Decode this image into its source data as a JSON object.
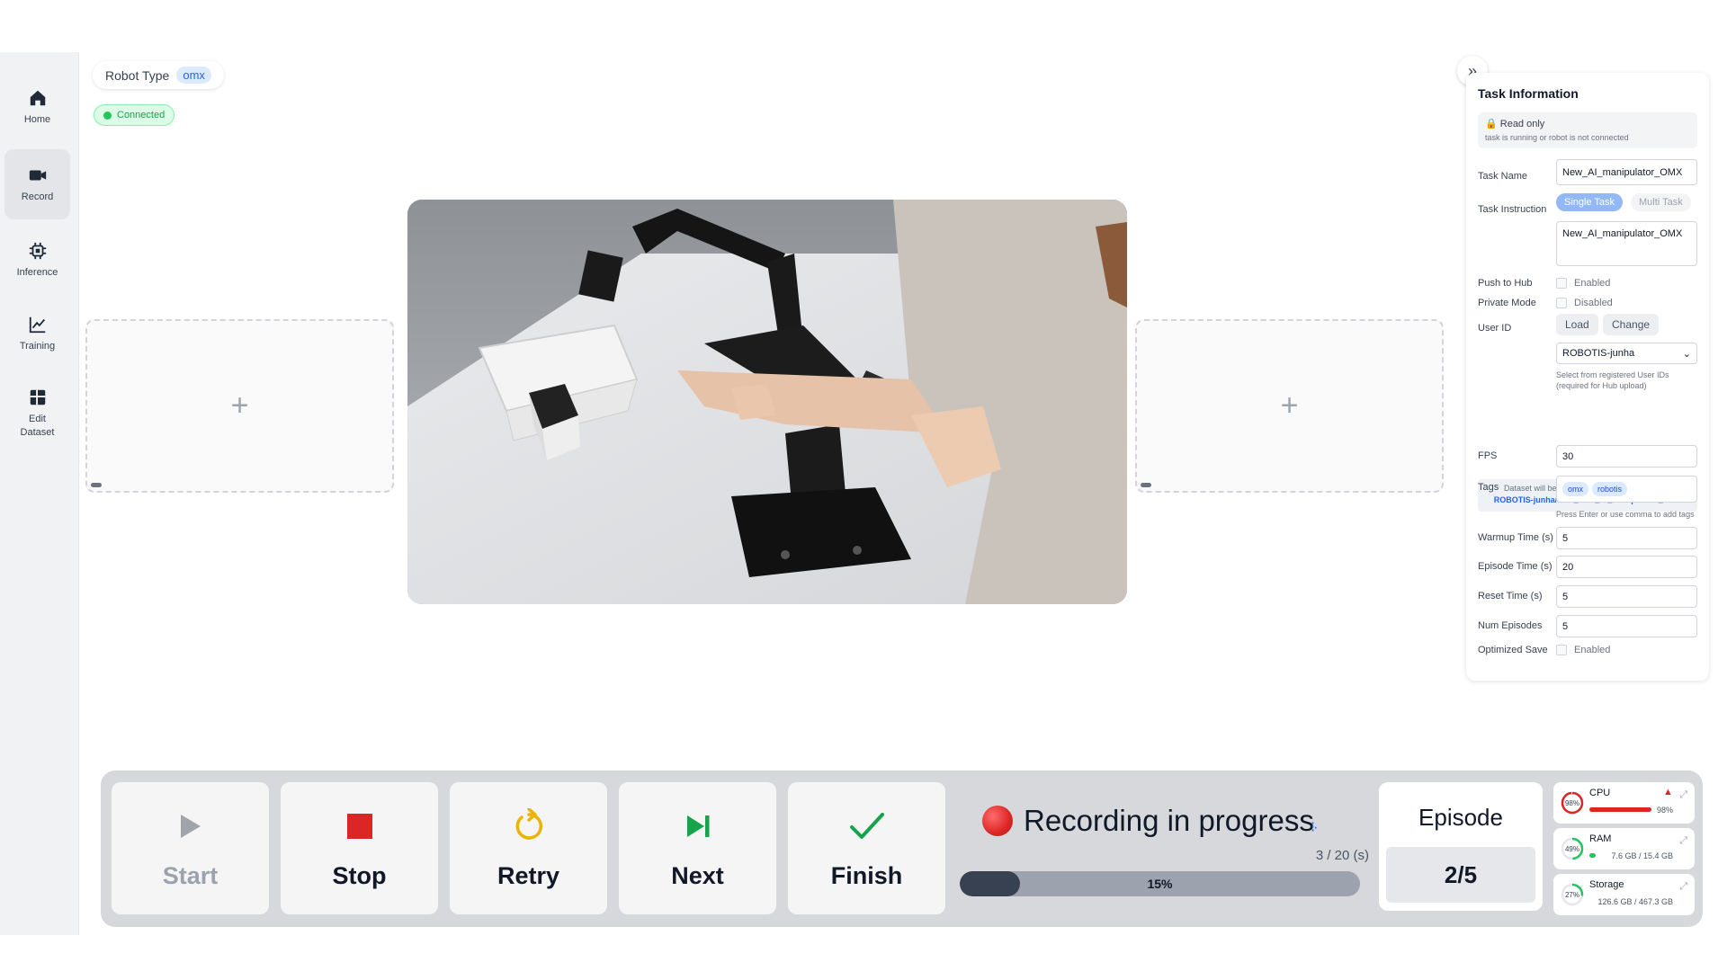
{
  "sidebar": {
    "items": [
      {
        "label": "Home",
        "icon": "home-icon"
      },
      {
        "label": "Record",
        "icon": "video-camera-icon",
        "active": true
      },
      {
        "label": "Inference",
        "icon": "chip-icon"
      },
      {
        "label": "Training",
        "icon": "chart-line-icon"
      },
      {
        "label": "Edit\nDataset",
        "icon": "grid-icon"
      }
    ]
  },
  "header": {
    "robot_type_label": "Robot Type",
    "robot_type_value": "omx",
    "status": "Connected"
  },
  "task": {
    "title": "Task Information",
    "readonly_title": "🔒 Read only",
    "readonly_desc": "task is running or robot is not connected",
    "task_name_label": "Task Name",
    "task_name_value": "New_AI_manipulator_OMX",
    "instruction_label": "Task Instruction",
    "single_task": "Single Task",
    "multi_task": "Multi Task",
    "instruction_value": "New_AI_manipulator_OMX",
    "push_label": "Push to Hub",
    "push_value": "Enabled",
    "private_label": "Private Mode",
    "private_value": "Disabled",
    "user_id_label": "User ID",
    "load_btn": "Load",
    "change_btn": "Change",
    "user_id_value": "ROBOTIS-junha",
    "user_hint": "Select from registered User IDs (required for Hub upload)",
    "repo_note": "Dataset will be saved with the following repo id",
    "repo_id": "ROBOTIS-junha/omx_New_AI_manipulator_OMX",
    "fps_label": "FPS",
    "fps_value": "30",
    "tags_label": "Tags",
    "tags": [
      "omx",
      "robotis"
    ],
    "tags_hint": "Press Enter or use comma to add tags",
    "warmup_label": "Warmup Time (s)",
    "warmup_value": "5",
    "episode_time_label": "Episode Time (s)",
    "episode_time_value": "20",
    "reset_label": "Reset Time (s)",
    "reset_value": "5",
    "num_episodes_label": "Num Episodes",
    "num_episodes_value": "5",
    "optimized_label": "Optimized Save",
    "optimized_value": "Enabled"
  },
  "controls": {
    "start": "Start",
    "stop": "Stop",
    "retry": "Retry",
    "next": "Next",
    "finish": "Finish"
  },
  "recording": {
    "status": "Recording in progress",
    "time": "3 / 20 (s)",
    "progress": 0.15,
    "progress_label": "15%"
  },
  "episode": {
    "label": "Episode",
    "value": "2/5"
  },
  "system": {
    "cpu": {
      "label": "CPU",
      "pct_label": "98%",
      "sub": "98%",
      "pct": 0.98,
      "color": "#dc2626"
    },
    "ram": {
      "label": "RAM",
      "pct_label": "49%",
      "sub": "7.6 GB / 15.4 GB",
      "pct": 0.49,
      "color": "#22c55e"
    },
    "storage": {
      "label": "Storage",
      "pct_label": "27%",
      "sub": "126.6 GB / 467.3 GB",
      "pct": 0.27,
      "color": "#22c55e"
    }
  }
}
